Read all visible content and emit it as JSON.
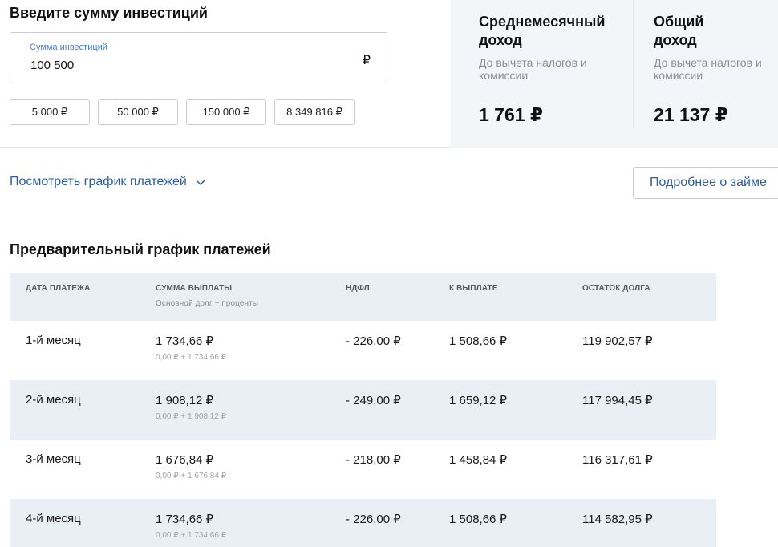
{
  "investment": {
    "title": "Введите сумму инвестиций",
    "input_label": "Сумма инвестиций",
    "input_value": "100 500",
    "currency": "₽",
    "chips": [
      "5 000 ₽",
      "50 000 ₽",
      "150 000 ₽",
      "8 349 816 ₽"
    ]
  },
  "income": {
    "monthly": {
      "title": "Среднемесячный доход",
      "note": "До вычета налогов и комиссии",
      "amount": "1 761 ₽"
    },
    "total": {
      "title": "Общий доход",
      "note": "До вычета налогов и комиссии",
      "amount": "21 137 ₽"
    }
  },
  "actions": {
    "view_schedule": "Посмотреть график платежей",
    "more_about_loan": "Подробнее о займе"
  },
  "schedule": {
    "title": "Предварительный график платежей",
    "headers": {
      "date": "Дата платежа",
      "amount": "Сумма выплаты",
      "amount_sub": "Основной долг + проценты",
      "tax": "НДФЛ",
      "payout": "К выплате",
      "remaining": "Остаток долга"
    },
    "rows": [
      {
        "date": "1-й месяц",
        "amount": "1 734,66 ₽",
        "breakdown": "0,00 ₽ + 1 734,66 ₽",
        "tax": "- 226,00 ₽",
        "payout": "1 508,66 ₽",
        "remaining": "119 902,57 ₽"
      },
      {
        "date": "2-й месяц",
        "amount": "1 908,12 ₽",
        "breakdown": "0,00 ₽ + 1 908,12 ₽",
        "tax": "- 249,00 ₽",
        "payout": "1 659,12 ₽",
        "remaining": "117 994,45 ₽"
      },
      {
        "date": "3-й месяц",
        "amount": "1 676,84 ₽",
        "breakdown": "0,00 ₽ + 1 676,84 ₽",
        "tax": "- 218,00 ₽",
        "payout": "1 458,84 ₽",
        "remaining": "116 317,61 ₽"
      },
      {
        "date": "4-й месяц",
        "amount": "1 734,66 ₽",
        "breakdown": "0,00 ₽ + 1 734,66 ₽",
        "tax": "- 226,00 ₽",
        "payout": "1 508,66 ₽",
        "remaining": "114 582,95 ₽"
      }
    ]
  }
}
